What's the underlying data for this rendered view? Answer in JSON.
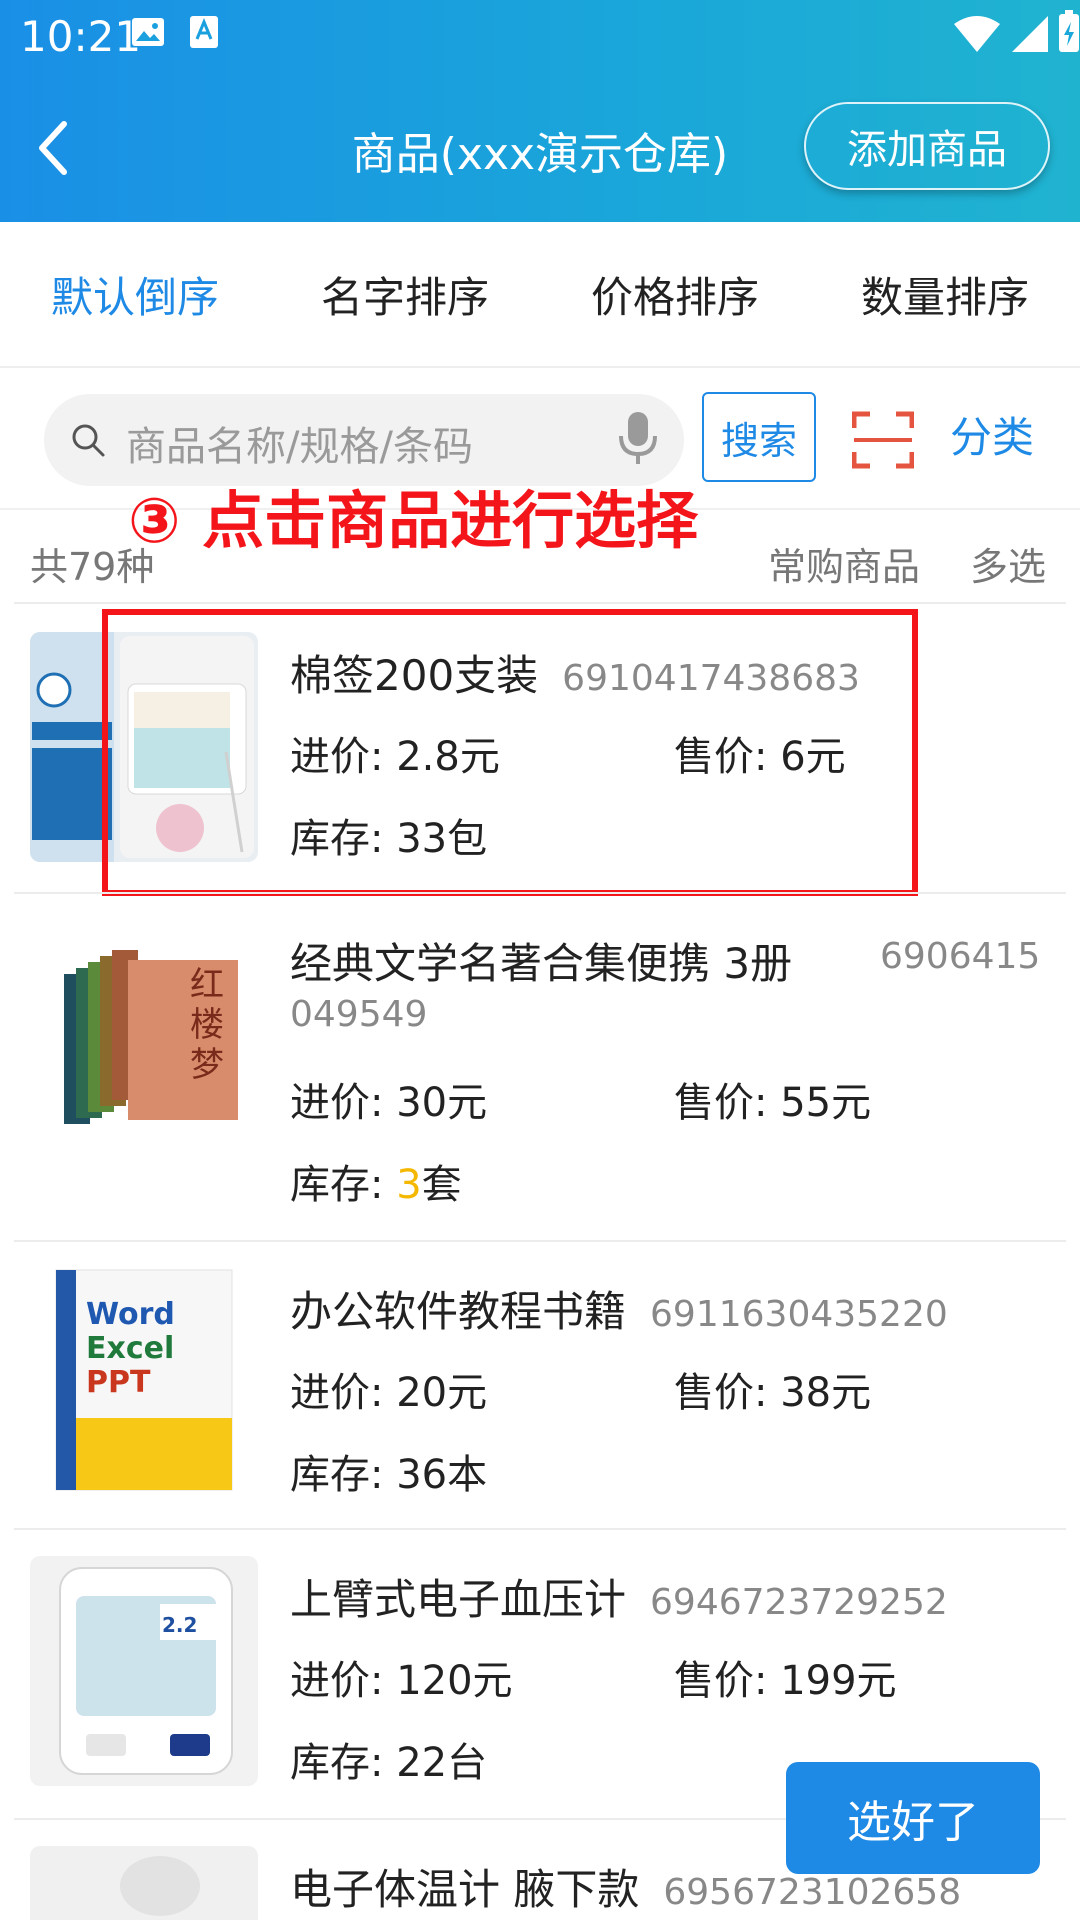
{
  "status_bar": {
    "time": "10:21"
  },
  "header": {
    "title": "商品(xxx演示仓库)",
    "add_button": "添加商品"
  },
  "sort_tabs": [
    "默认倒序",
    "名字排序",
    "价格排序",
    "数量排序"
  ],
  "search": {
    "placeholder": "商品名称/规格/条码",
    "button": "搜索",
    "category": "分类"
  },
  "annotation": "③ 点击商品进行选择",
  "list_header": {
    "count": "共79种",
    "frequent": "常购商品",
    "multi": "多选"
  },
  "labels": {
    "cost": "进价:",
    "price": "售价:",
    "stock": "库存:"
  },
  "items": [
    {
      "name": "棉签200支装",
      "code": "6910417438683",
      "cost": "2.8元",
      "price": "6元",
      "stock_num": "33",
      "stock_unit": "包"
    },
    {
      "name": "经典文学名著合集便携 3册",
      "code_part1": "6906415",
      "code_part2": "049549",
      "cost": "30元",
      "price": "55元",
      "stock_num": "3",
      "stock_unit": "套"
    },
    {
      "name": "办公软件教程书籍",
      "code": "6911630435220",
      "cost": "20元",
      "price": "38元",
      "stock_num": "36",
      "stock_unit": "本"
    },
    {
      "name": "上臂式电子血压计",
      "code": "6946723729252",
      "cost": "120元",
      "price": "199元",
      "stock_num": "22",
      "stock_unit": "台"
    },
    {
      "name": "电子体温计 腋下款",
      "code": "6956723102658"
    }
  ],
  "done_button": "选好了",
  "colors": {
    "accent": "#1e8ae6",
    "annotation_red": "#f4151b",
    "stock_highlight": "#f5b800"
  }
}
